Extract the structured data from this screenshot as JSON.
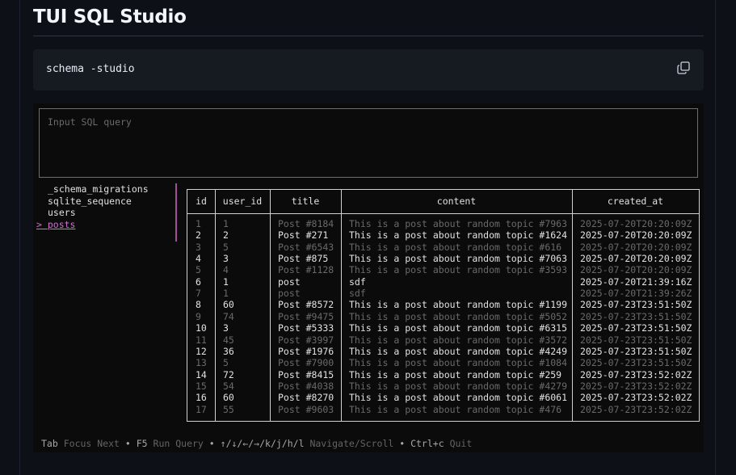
{
  "page": {
    "title": "TUI SQL Studio",
    "code_block": {
      "command": "schema -studio",
      "copy_icon": "copy-icon"
    }
  },
  "app": {
    "query_input": {
      "placeholder": "Input SQL query",
      "value": ""
    },
    "tables": [
      {
        "name": "_schema_migrations",
        "selected": false
      },
      {
        "name": "sqlite_sequence",
        "selected": false
      },
      {
        "name": "users",
        "selected": false
      },
      {
        "name": "posts",
        "selected": true,
        "marker": "> "
      }
    ],
    "results": {
      "columns": [
        "id",
        "user_id",
        "title",
        "content",
        "created_at"
      ],
      "rows": [
        [
          "1",
          "1",
          "Post #8184",
          "This is a post about random topic #7963",
          "2025-07-20T20:20:09Z"
        ],
        [
          "2",
          "2",
          "Post #271",
          "This is a post about random topic #1624",
          "2025-07-20T20:20:09Z"
        ],
        [
          "3",
          "5",
          "Post #6543",
          "This is a post about random topic #616",
          "2025-07-20T20:20:09Z"
        ],
        [
          "4",
          "3",
          "Post #875",
          "This is a post about random topic #7063",
          "2025-07-20T20:20:09Z"
        ],
        [
          "5",
          "4",
          "Post #1128",
          "This is a post about random topic #3593",
          "2025-07-20T20:20:09Z"
        ],
        [
          "6",
          "1",
          "post",
          "sdf",
          "2025-07-20T21:39:16Z"
        ],
        [
          "7",
          "1",
          "post",
          "sdf",
          "2025-07-20T21:39:26Z"
        ],
        [
          "8",
          "60",
          "Post #8572",
          "This is a post about random topic #1199",
          "2025-07-23T23:51:50Z"
        ],
        [
          "9",
          "74",
          "Post #9475",
          "This is a post about random topic #5052",
          "2025-07-23T23:51:50Z"
        ],
        [
          "10",
          "3",
          "Post #5333",
          "This is a post about random topic #6315",
          "2025-07-23T23:51:50Z"
        ],
        [
          "11",
          "45",
          "Post #3997",
          "This is a post about random topic #3572",
          "2025-07-23T23:51:50Z"
        ],
        [
          "12",
          "36",
          "Post #1976",
          "This is a post about random topic #4249",
          "2025-07-23T23:51:50Z"
        ],
        [
          "13",
          "5",
          "Post #7900",
          "This is a post about random topic #1084",
          "2025-07-23T23:51:50Z"
        ],
        [
          "14",
          "72",
          "Post #8415",
          "This is a post about random topic #259",
          "2025-07-23T23:52:02Z"
        ],
        [
          "15",
          "54",
          "Post #4038",
          "This is a post about random topic #4279",
          "2025-07-23T23:52:02Z"
        ],
        [
          "16",
          "60",
          "Post #8270",
          "This is a post about random topic #6061",
          "2025-07-23T23:52:02Z"
        ],
        [
          "17",
          "55",
          "Post #9603",
          "This is a post about random topic #476",
          "2025-07-23T23:52:02Z"
        ]
      ]
    },
    "status_bar": [
      {
        "key": "Tab",
        "desc": "Focus Next"
      },
      {
        "key": "F5",
        "desc": "Run Query"
      },
      {
        "key": "↑/↓/←/→/k/j/h/l",
        "desc": "Navigate/Scroll"
      },
      {
        "key": "Ctrl+c",
        "desc": "Quit"
      }
    ],
    "status_separator": " • "
  }
}
